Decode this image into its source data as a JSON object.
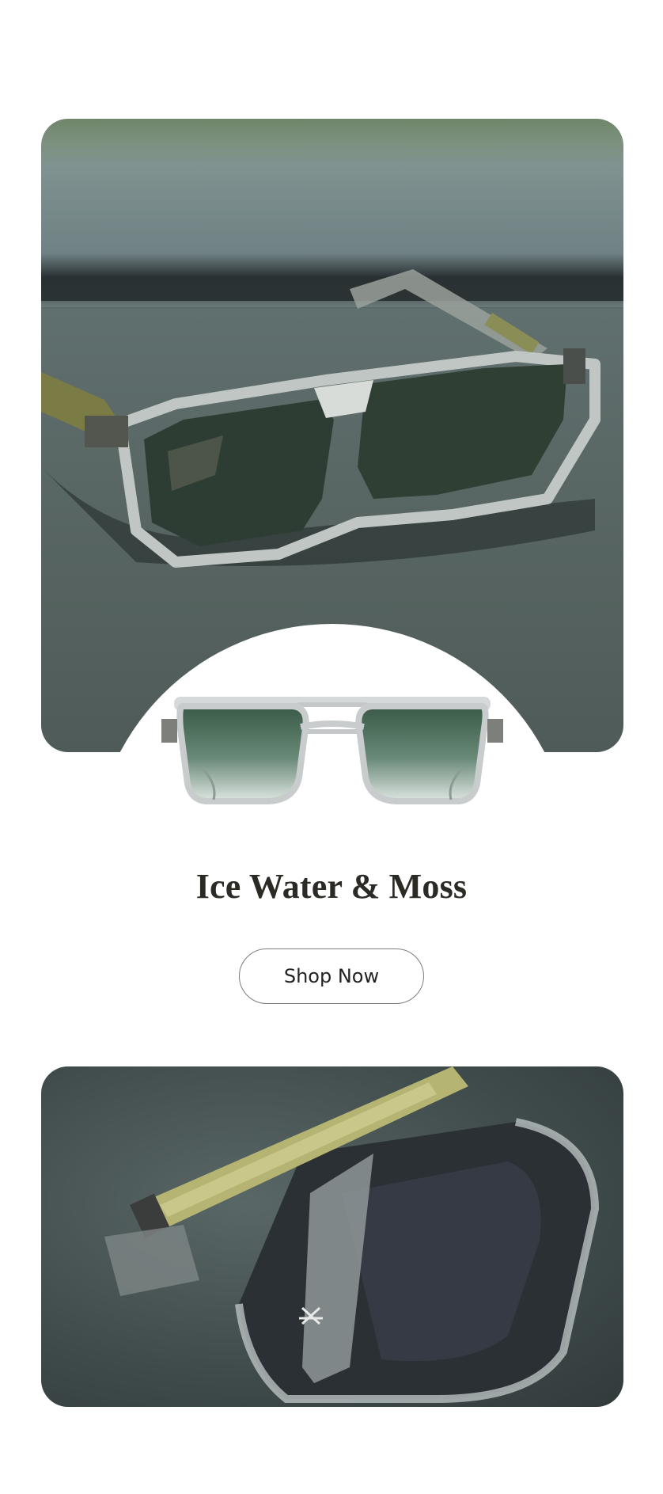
{
  "product": {
    "name": "Ice Water & Moss"
  },
  "cta": {
    "label": "Shop Now"
  },
  "images": {
    "hero_icon": "sunglasses-on-dashboard",
    "cutout_icon": "sunglasses-front-view",
    "detail_icon": "sunglasses-closeup-temple"
  },
  "colors": {
    "lens": "#3f5a48",
    "frame": "#c9cccc",
    "moss_accent": "#a9a95a",
    "title_text": "#2b2a25"
  }
}
